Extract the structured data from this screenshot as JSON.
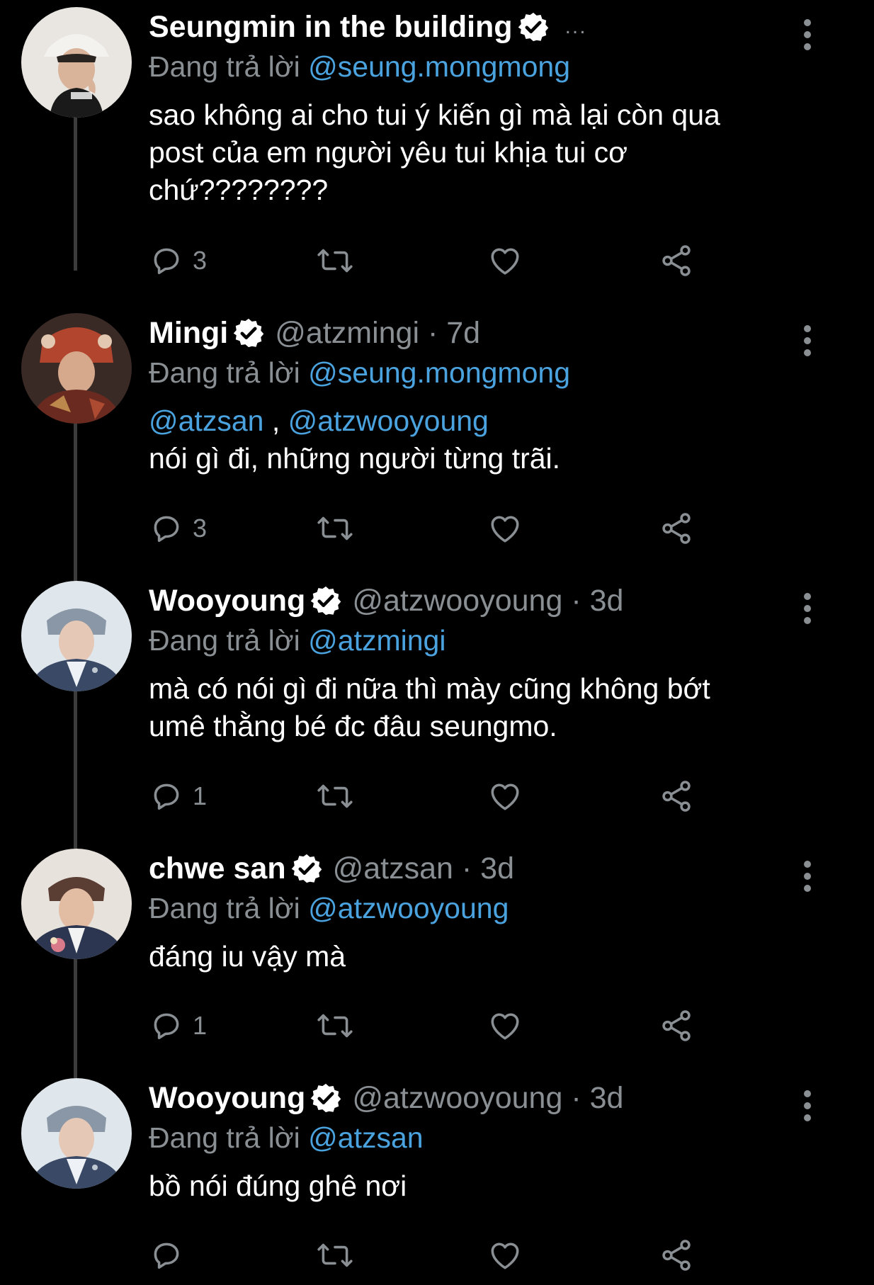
{
  "thread": {
    "tweets": [
      {
        "display_name": "Seungmin in the building",
        "handle": "",
        "time": "",
        "header_suffix": "...",
        "reply_prefix": "Đang trả lời",
        "reply_to": "@seung.mongmong",
        "mentions": [],
        "body_lines": [
          "sao không ai cho tui ý kiến gì mà lại còn qua",
          "post của em người yêu tui khịa tui cơ",
          "chứ????????"
        ],
        "reply_count": "3"
      },
      {
        "display_name": "Mingi",
        "handle": "@atzmingi",
        "time": "7d",
        "reply_prefix": "Đang trả lời",
        "reply_to": "@seung.mongmong",
        "mentions": [
          "@atzsan",
          "@atzwooyoung"
        ],
        "mention_separator": " , ",
        "body_lines": [
          "nói gì đi, những người từng trãi."
        ],
        "reply_count": "3"
      },
      {
        "display_name": "Wooyoung",
        "handle": "@atzwooyoung",
        "time": "3d",
        "reply_prefix": "Đang trả lời",
        "reply_to": "@atzmingi",
        "mentions": [],
        "body_lines": [
          "mà có nói gì đi nữa thì mày cũng không bớt",
          "umê thằng bé đc đâu seungmo."
        ],
        "reply_count": "1"
      },
      {
        "display_name": "chwe san",
        "handle": "@atzsan",
        "time": "3d",
        "reply_prefix": "Đang trả lời",
        "reply_to": "@atzwooyoung",
        "mentions": [],
        "body_lines": [
          "đáng iu vậy mà"
        ],
        "reply_count": "1"
      },
      {
        "display_name": "Wooyoung",
        "handle": "@atzwooyoung",
        "time": "3d",
        "reply_prefix": "Đang trả lời",
        "reply_to": "@atzsan",
        "mentions": [],
        "body_lines": [
          "bồ nói đúng ghê nơi"
        ],
        "reply_count": ""
      }
    ]
  },
  "icons": {
    "verified": "verified-badge-icon",
    "reply": "reply-bubble-icon",
    "retweet": "retweet-icon",
    "like": "heart-icon",
    "share": "share-icon",
    "more": "more-vertical-icon"
  },
  "colors": {
    "background": "#000000",
    "text": "#ffffff",
    "muted": "#8a8f94",
    "mention": "#4aa3df",
    "thread_line": "#3c3c3c"
  }
}
